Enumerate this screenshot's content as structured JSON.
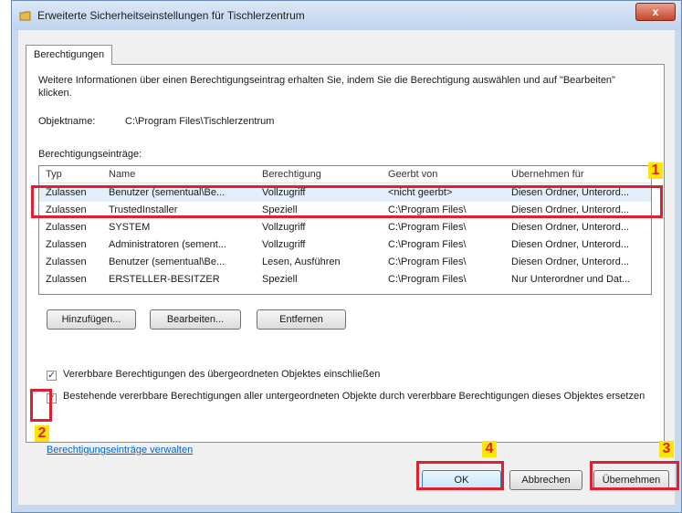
{
  "window": {
    "title": "Erweiterte Sicherheitseinstellungen für Tischlerzentrum",
    "close_label": "x"
  },
  "tab": {
    "label": "Berechtigungen"
  },
  "info_text": "Weitere Informationen über einen Berechtigungseintrag erhalten Sie, indem Sie die Berechtigung auswählen und auf \"Bearbeiten\" klicken.",
  "object": {
    "label": "Objektname:",
    "value": "C:\\Program Files\\Tischlerzentrum"
  },
  "entries_label": "Berechtigungseinträge:",
  "table": {
    "columns": [
      "Typ",
      "Name",
      "Berechtigung",
      "Geerbt von",
      "Übernehmen für"
    ],
    "rows": [
      [
        "Zulassen",
        "Benutzer (sementual\\Be...",
        "Vollzugriff",
        "<nicht geerbt>",
        "Diesen Ordner, Unterord..."
      ],
      [
        "Zulassen",
        "TrustedInstaller",
        "Speziell",
        "C:\\Program Files\\",
        "Diesen Ordner, Unterord..."
      ],
      [
        "Zulassen",
        "SYSTEM",
        "Vollzugriff",
        "C:\\Program Files\\",
        "Diesen Ordner, Unterord..."
      ],
      [
        "Zulassen",
        "Administratoren (sement...",
        "Vollzugriff",
        "C:\\Program Files\\",
        "Diesen Ordner, Unterord..."
      ],
      [
        "Zulassen",
        "Benutzer (sementual\\Be...",
        "Lesen, Ausführen",
        "C:\\Program Files\\",
        "Diesen Ordner, Unterord..."
      ],
      [
        "Zulassen",
        "ERSTELLER-BESITZER",
        "Speziell",
        "C:\\Program Files\\",
        "Nur Unterordner und Dat..."
      ]
    ]
  },
  "buttons": {
    "add": "Hinzufügen...",
    "edit": "Bearbeiten...",
    "remove": "Entfernen"
  },
  "checkboxes": {
    "inherit": {
      "label": "Vererbbare Berechtigungen des übergeordneten Objektes einschließen",
      "checked": true
    },
    "replace": {
      "label": "Bestehende vererbbare Berechtigungen aller untergeordneten Objekte durch vererbbare Berechtigungen dieses Objektes ersetzen",
      "checked": true
    }
  },
  "manage_link": "Berechtigungseinträge verwalten",
  "footer": {
    "ok": "OK",
    "cancel": "Abbrechen",
    "apply": "Übernehmen"
  },
  "markers": {
    "m1": "1",
    "m2": "2",
    "m3": "3",
    "m4": "4"
  },
  "colors": {
    "highlight": "#e1202f",
    "marker_bg": "#ffe600"
  }
}
